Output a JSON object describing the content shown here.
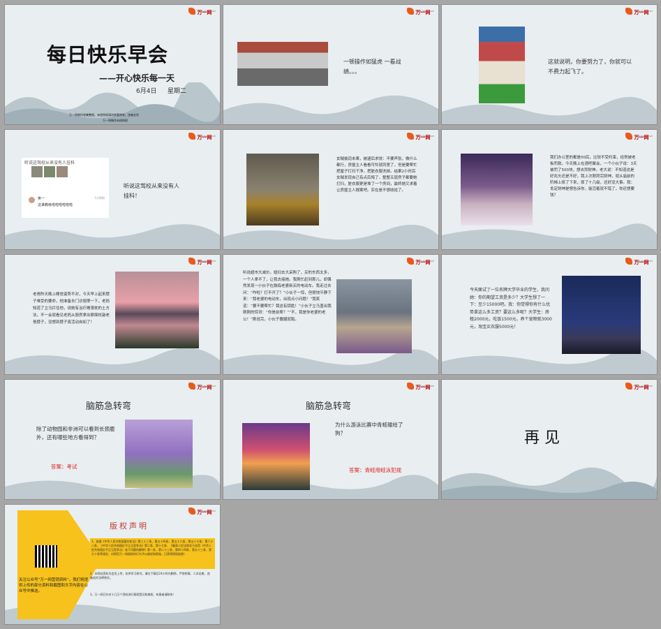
{
  "logo": {
    "text": "万一网",
    "sub": "WWW.WAN1.COM"
  },
  "s1": {
    "title": "每日快乐早会",
    "subtitle": "——开心快乐每一天",
    "date": "6月4日",
    "weekday": "星期二",
    "notice1": "万一网制作收集整理，未经授权请勿转载转发，违者必究",
    "notice2": "万一网制作未经授权"
  },
  "s2": {
    "text": "一顿操作如猛虎 一看战绩。。。"
  },
  "s3": {
    "text": "这就说明，你要努力了，你就可以不费力起飞了。"
  },
  "s4": {
    "chat_top": "听说这驾校从来没有人挂科",
    "chat_user": "笑一",
    "chat_msg": "这谁教练啦啦啦啦啦啦",
    "chat_time": "1分钟前",
    "text": "听说这驾校从来没有人挂科！"
  },
  "s5": {
    "text": "女贼偷窃未果，被逮后求饶：不要声张，做什么都行，房屋主人看看可怜就同意了，但是要帮忙把屋子打扫干净，把脏衣服洗掉。结果2小时后女贼发现自己有点后悔了，整整五层房子都要她打扫，脏衣服更是堆了一个房间，最终她又求着让房屋主人报案吧。实在是不想收拾了。"
  },
  "s6": {
    "text": "我们办公室的都是00后，比较不受约束，经常被老板罚款。今天晚上在酒吧聚会，一个小伙子说：3天被罚了500块，想去拜财神。老大说：不知道这是好兆头还是不好，我上次刚拜完财神，就从庙前的阶梯上摔了下来，摔了十几级，还好没大事。我：肯定财神是想告诉你，能活着就不错了，你还想要钱？"
  },
  "s7": {
    "text": "老爸昨天晚上睡觉姿势不对，今天早上起来脖子难受的要命，他准备去门诊按摩一下，老妈知道了立马拦住他，说她有治疗睡落枕的土方法，不一会就看见老妈从厨房拿出擀面杖敲老爸脖子，没想到脖子真活动自如了！"
  },
  "s8": {
    "text": "听说超市大减价，媳妇去大采购了，买的东西太多，一个人拿不了，让我去接她。我刚忙赶到那儿，却偶然发现一小伙子在鼓捣老婆新买的电动车。我走过去问：“咋啦？打不开了？”小伙子一惊，但很快平静下来：“我老婆的电动车，出现点小问题！”我笑道：“要不要帮忙？我这有钥匙！”小伙子立马盖出我刚刚的惊讶：“你是前辈？”“不，我是你老婆的老公！”刚说完，小伙子撒腿就跑。"
  },
  "s9": {
    "text": "今天面试了一位名牌大学毕业的学生，我问她：你的期望工资是多少？大学生想了一下：至少15000吧。我：你觉得你有什么优势拿这么多工资？要这么多呢？大学生：房租2000元，吃饭1500元，养个宠物就3000元，淘宝买衣服5000元！"
  },
  "s10": {
    "title": "脑筋急转弯",
    "question": "除了动物园和非洲可以看到长颈鹿外，还有哪些地方看得到？",
    "answer": "答案：考试"
  },
  "s11": {
    "title": "脑筋急转弯",
    "question": "为什么游泳比赛中青蛙输给了狗？",
    "answer": "答案：青蛙用蛙泳犯规"
  },
  "s12": {
    "text": "再 见"
  },
  "s13": {
    "title": "版权声明",
    "item1": "1、依据《中华人民共和国著作权法》第三十三条、第五十四条、第五十六条、第五十七条、第六十八条、《中华人民共和国反不正当竞争法》第二条、第十七条、《最高人民法院关于适用〈中华人民共和国反不正当竞争法〉若干问题的解释》第一条、第二十三条、第四十四条、第五十三条、第七十条等规定，对侵犯万一网版权的行为予以维权和索赔，已获得侵权赔偿！",
    "item2": "2、本网站资料为会员上传，仅供学习研究，请在下载后24小时内删除，严禁转载、二次出售，违者追究法律责任。",
    "item3": "3、万一网已针对十几万个资料进行版权登记和维权，有意者请联系！",
    "qr_note": "关注公众号“万一网营销资料”，我们将提供上传的部分资料和截图和文字内容在公众号中推送。"
  },
  "colors": {
    "red": "#e02020",
    "title": "#1a1a1a",
    "yellow": "#f6c21b"
  }
}
